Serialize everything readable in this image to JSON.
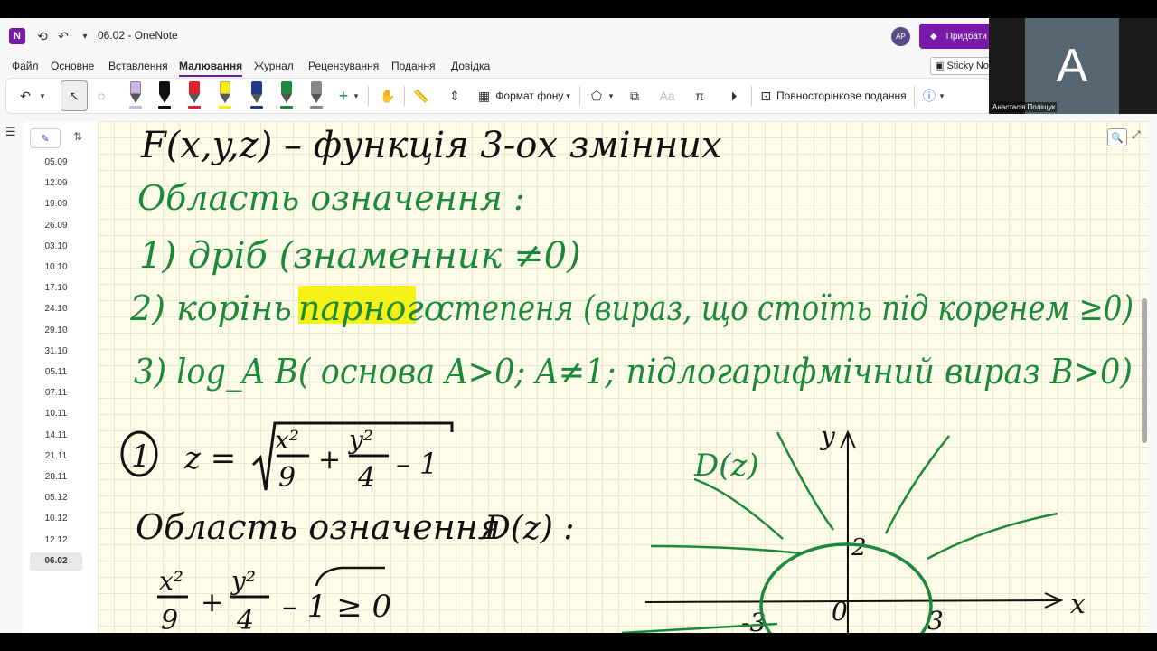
{
  "window": {
    "title": "06.02  -  OneNote",
    "app_logo": "N"
  },
  "topbar": {
    "avatar": "AP",
    "premium_label": "Придбати"
  },
  "menu": [
    {
      "label": "Файл"
    },
    {
      "label": "Основне"
    },
    {
      "label": "Вставлення"
    },
    {
      "label": "Малювання"
    },
    {
      "label": "Журнал"
    },
    {
      "label": "Рецензування"
    },
    {
      "label": "Подання"
    },
    {
      "label": "Довідка"
    }
  ],
  "sticky_label": "Sticky No",
  "ribbon": {
    "background_format": "Формат фону",
    "full_page_view": "Повносторінкове подання",
    "pens": [
      {
        "name": "pen-lavender",
        "color": "#c9b6e4"
      },
      {
        "name": "pen-black",
        "color": "#111111"
      },
      {
        "name": "pen-red",
        "color": "#e0202a"
      },
      {
        "name": "highlighter-yellow",
        "color": "#f5f000"
      },
      {
        "name": "pen-navy",
        "color": "#1e3a8a"
      },
      {
        "name": "pen-green",
        "color": "#1a8a3a"
      },
      {
        "name": "pen-gray",
        "color": "#888888"
      }
    ]
  },
  "video": {
    "initial": "A",
    "name": "Анастасія Поліщук"
  },
  "pages": [
    {
      "label": "05.09"
    },
    {
      "label": "12.09"
    },
    {
      "label": "19.09"
    },
    {
      "label": "26.09"
    },
    {
      "label": "03.10"
    },
    {
      "label": "10.10"
    },
    {
      "label": "17.10"
    },
    {
      "label": "24.10"
    },
    {
      "label": "29.10"
    },
    {
      "label": "31.10"
    },
    {
      "label": "05.11"
    },
    {
      "label": "07.11"
    },
    {
      "label": "10.11"
    },
    {
      "label": "14.11"
    },
    {
      "label": "21.11"
    },
    {
      "label": "28.11"
    },
    {
      "label": "05.12"
    },
    {
      "label": "10.12"
    },
    {
      "label": "12.12"
    },
    {
      "label": "06.02"
    }
  ],
  "selected_page": "06.02",
  "notes": {
    "line1": "F(x,y,z) – функція 3-ох змінних",
    "line2": "Область означення :",
    "line3": "1) дріб (знаменник ≠0)",
    "line4a": "2) корінь",
    "line4b": "парного",
    "line4c": "степеня (вираз, що стоїть під коренем ≥0)",
    "line5": "3) log_A B( основа A>0; A≠1; підлогарифмічний вираз B>0)",
    "ex_number": "1",
    "eq_lhs": "z =",
    "eq_frac1_num": "x²",
    "eq_frac1_den": "9",
    "eq_plus": "+",
    "eq_frac2_num": "y²",
    "eq_frac2_den": "4",
    "eq_tail": "– 1",
    "domain_title": "Область означення",
    "domain_dz": "D(z) :",
    "ineq_frac1_num": "x²",
    "ineq_frac1_den": "9",
    "ineq_plus": "+",
    "ineq_frac2_num": "y²",
    "ineq_frac2_den": "4",
    "ineq_tail": "– 1 ≥ 0",
    "graph_label": "D(z)",
    "axis_y": "y",
    "axis_x": "x",
    "tick_2": "2",
    "tick_0": "0",
    "tick_3": "3",
    "tick_neg3": "-3"
  },
  "colors": {
    "accent": "#7719aa",
    "ink_black": "#111111",
    "ink_green": "#1a8a3a",
    "highlight": "#f5f000"
  }
}
